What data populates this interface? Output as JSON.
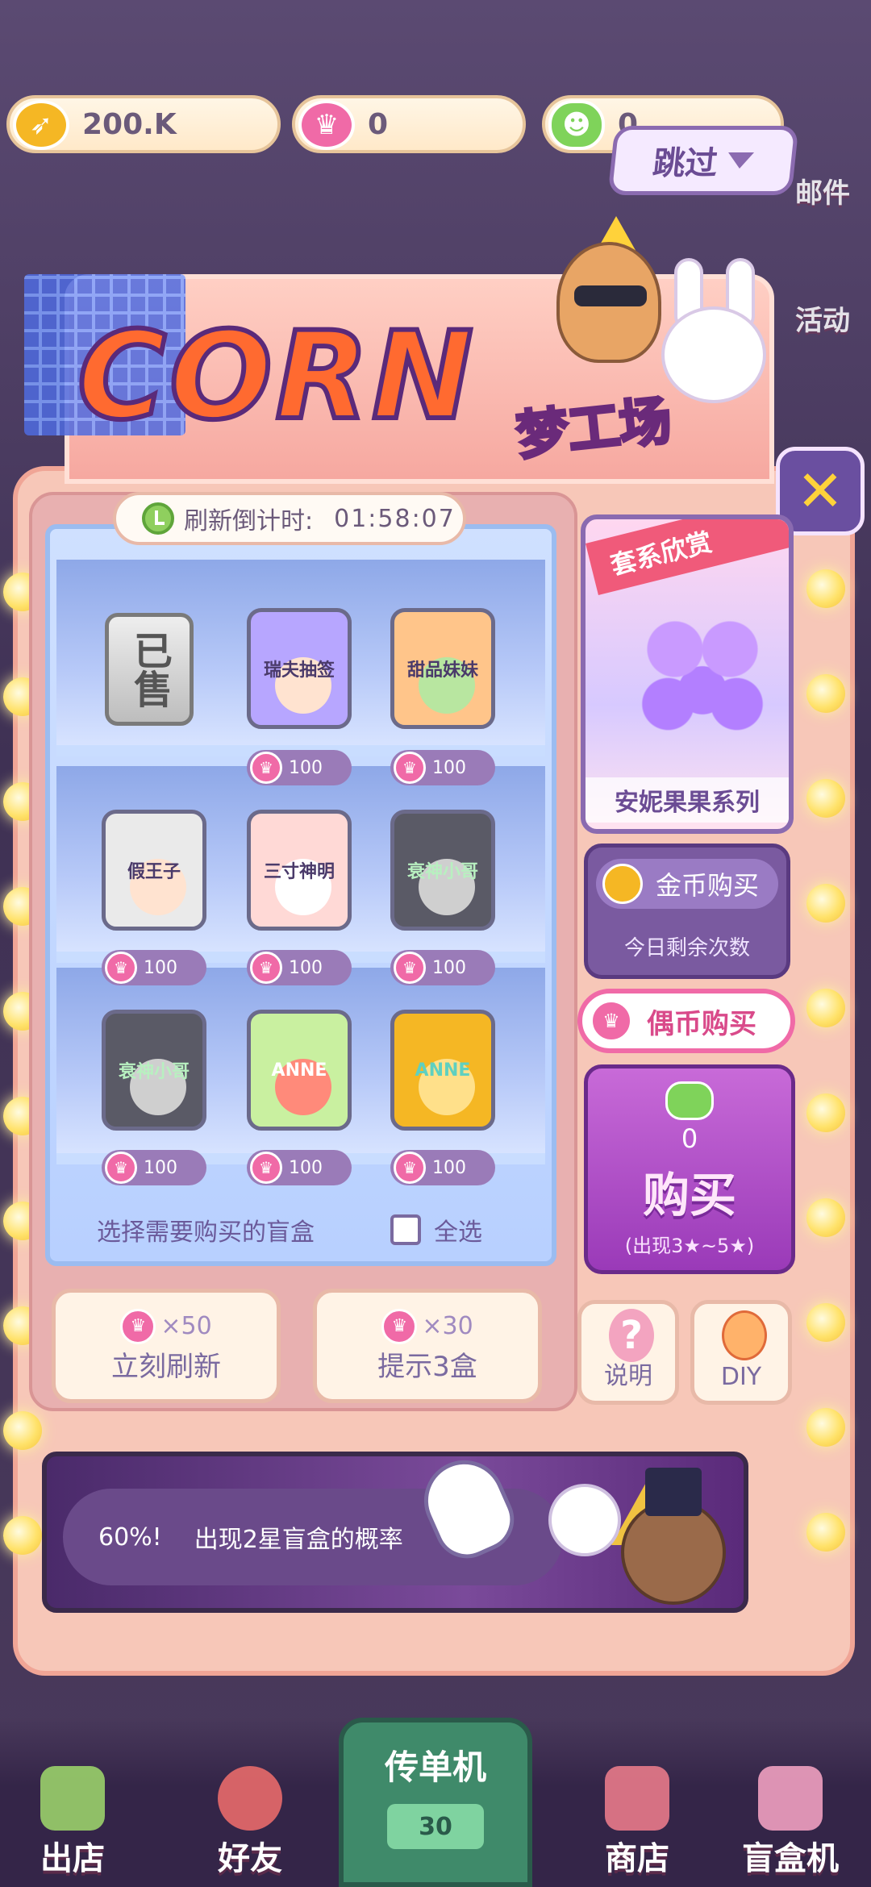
{
  "resources": {
    "gold": "200.K",
    "crown": "0",
    "gem": "0"
  },
  "skip_button": "跳过",
  "background_side_labels": [
    "邮件",
    "活动"
  ],
  "header": {
    "logo": "CORN",
    "subtitle": "梦工场"
  },
  "close_icon": "✕",
  "shelf": {
    "timer_label": "刷新倒计时:",
    "timer_value": "01:58:07",
    "sold_label": "已售",
    "boxes": [
      {
        "label": "瑞夫抽签",
        "price": "100"
      },
      {
        "label": "甜品妹妹",
        "price": "100"
      },
      {
        "label": "假王子",
        "price": "100"
      },
      {
        "label": "三寸神明",
        "price": "100"
      },
      {
        "label": "衰神小哥",
        "price": "100"
      },
      {
        "label": "衰神小哥",
        "price": "100"
      },
      {
        "label": "ANNE",
        "price": "100"
      },
      {
        "label": "ANNE",
        "price": "100"
      }
    ],
    "select_prompt": "选择需要购买的盲盒",
    "select_all": "全选"
  },
  "actions": {
    "refresh": {
      "cost": "×50",
      "label": "立刻刷新"
    },
    "hint": {
      "cost": "×30",
      "label": "提示3盒"
    }
  },
  "right_column": {
    "series_ribbon": "套系欣赏",
    "series_name": "安妮果果系列",
    "coin_buy_label": "金币购买",
    "remaining_label": "今日剩余次数",
    "idol_buy_label": "偶币购买",
    "buy_count": "0",
    "buy_label": "购买",
    "buy_note": "(出现3★~5★)",
    "help_label": "说明",
    "diy_label": "DIY"
  },
  "banner": {
    "percent": "60%!",
    "text": "出现2星盲盒的概率"
  },
  "bottom_nav": {
    "items": [
      "出店",
      "好友",
      "商店",
      "盲盒机"
    ],
    "flyer_label": "传单机",
    "flyer_count": "30"
  },
  "colors": {
    "accent": "#f06aa7",
    "gold": "#f5b724",
    "gem": "#7fd35a",
    "purple": "#6a4fa0"
  }
}
